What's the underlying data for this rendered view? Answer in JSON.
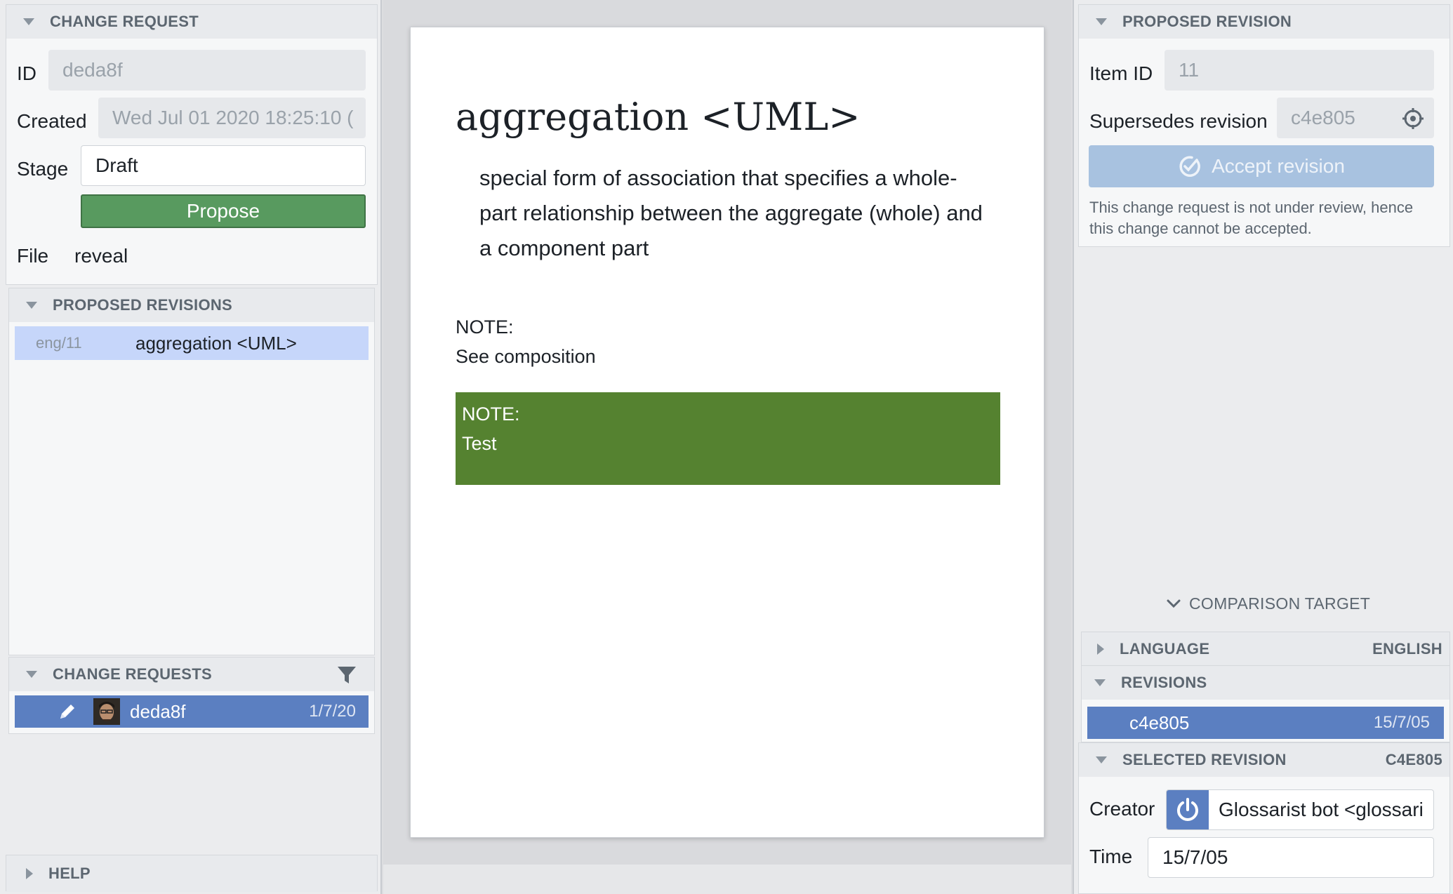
{
  "left": {
    "change_request": {
      "header": "CHANGE REQUEST",
      "id_label": "ID",
      "id_value": "deda8f",
      "created_label": "Created",
      "created_value": "Wed Jul 01 2020 18:25:10 (",
      "stage_label": "Stage",
      "stage_value": "Draft",
      "propose_label": "Propose",
      "file_label": "File",
      "file_value": "reveal"
    },
    "proposed_revisions": {
      "header": "PROPOSED REVISIONS",
      "items": [
        {
          "code": "eng/11",
          "title": "aggregation <UML>"
        }
      ]
    },
    "change_requests": {
      "header": "CHANGE REQUESTS",
      "items": [
        {
          "id": "deda8f",
          "date": "1/7/20"
        }
      ]
    },
    "help": {
      "header": "HELP"
    }
  },
  "document": {
    "term": "aggregation <UML>",
    "definition": "special form of association that specifies a whole-part relationship between the aggregate (whole) and a component part",
    "note1_label": "NOTE:",
    "note1_text": "See composition",
    "note2_label": "NOTE:",
    "note2_text": "Test"
  },
  "right": {
    "proposed_revision": {
      "header": "PROPOSED REVISION",
      "item_id_label": "Item ID",
      "item_id_value": "11",
      "supersedes_label": "Supersedes revision",
      "supersedes_value": "c4e805",
      "accept_label": "Accept revision",
      "notice": "This change request is not under review, hence this change cannot be accepted."
    },
    "comparison_target": {
      "label": "COMPARISON TARGET"
    },
    "language": {
      "header": "LANGUAGE",
      "value": "ENGLISH"
    },
    "revisions": {
      "header": "REVISIONS",
      "items": [
        {
          "id": "c4e805",
          "date": "15/7/05"
        }
      ]
    },
    "selected_revision": {
      "header": "SELECTED REVISION",
      "code": "C4E805",
      "creator_label": "Creator",
      "creator_value": "Glossarist bot <glossari",
      "time_label": "Time",
      "time_value": "15/7/05"
    }
  },
  "colors": {
    "accent_blue": "#5b7fc1",
    "highlight_blue": "#c6d6fa",
    "propose_green": "#589a5f",
    "note_green": "#558230",
    "accept_disabled": "#a8c2e0"
  }
}
